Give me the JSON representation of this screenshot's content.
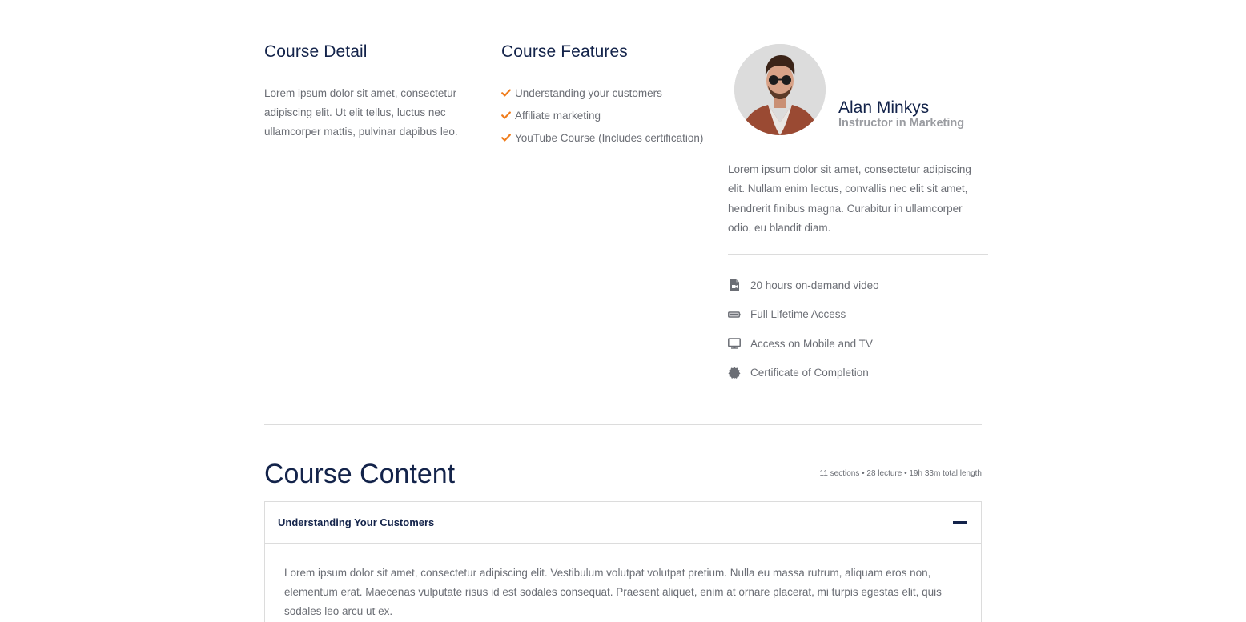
{
  "course_detail": {
    "heading": "Course Detail",
    "text": "Lorem ipsum dolor sit amet, consectetur adipiscing elit. Ut elit tellus, luctus nec ullamcorper mattis, pulvinar dapibus leo."
  },
  "course_features": {
    "heading": "Course Features",
    "items": [
      "Understanding your customers",
      "Affiliate marketing",
      "YouTube Course (Includes certification)"
    ],
    "icon": "check-icon",
    "icon_color": "#f07c1b"
  },
  "instructor": {
    "name": "Alan Minkys",
    "role": "Instructor in Marketing",
    "bio": "Lorem ipsum dolor sit amet, consectetur adipiscing elit. Nullam enim lectus, convallis nec elit sit amet, hendrerit finibus magna. Curabitur in ullamcorper odio, eu blandit diam.",
    "includes": [
      {
        "icon": "video-file-icon",
        "label": "20 hours on-demand video"
      },
      {
        "icon": "battery-icon",
        "label": "Full Lifetime Access"
      },
      {
        "icon": "monitor-icon",
        "label": "Access on Mobile and TV"
      },
      {
        "icon": "certificate-icon",
        "label": "Certificate of Completion"
      }
    ]
  },
  "course_content": {
    "title": "Course Content",
    "meta": "11 sections • 28 lecture • 19h 33m total length",
    "sections": [
      {
        "title": "Understanding Your Customers",
        "expanded": true,
        "body": "Lorem ipsum dolor sit amet, consectetur adipiscing elit. Vestibulum volutpat volutpat pretium. Nulla eu massa rutrum, aliquam eros non, elementum erat. Maecenas vulputate risus id est sodales consequat. Praesent aliquet, enim at ornare placerat, mi turpis egestas elit, quis sodales leo arcu ut ex."
      }
    ]
  },
  "colors": {
    "heading": "#13234a",
    "text": "#6b6e75",
    "accent": "#f07c1b",
    "border": "#dcdcdc"
  }
}
